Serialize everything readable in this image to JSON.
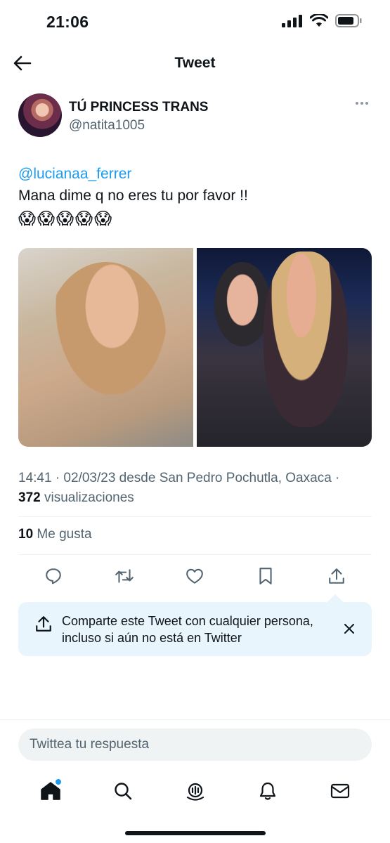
{
  "status_bar": {
    "time": "21:06"
  },
  "nav": {
    "title": "Tweet"
  },
  "tweet": {
    "author": {
      "display_name": "TÚ PRINCESS TRANS",
      "handle": "@natita1005"
    },
    "mention": "@lucianaa_ferrer",
    "text": "Mana dime q no eres tu por favor !!",
    "emojis": "😱😱😱😱😱",
    "timestamp_line": "14:41 · 02/03/23 desde San Pedro Pochutla, Oaxaca ·",
    "views_count": "372",
    "views_label": "visualizaciones",
    "likes_count": "10",
    "likes_label": "Me gusta"
  },
  "share_card": {
    "text": "Comparte este Tweet con cualquier persona, incluso si aún no está en Twitter"
  },
  "reply": {
    "placeholder": "Twittea tu respuesta"
  },
  "icons": {
    "back": "back-arrow-icon",
    "more": "more-dots-icon",
    "actions": [
      "reply-icon",
      "retweet-icon",
      "like-icon",
      "bookmark-icon",
      "share-icon"
    ],
    "tabs": [
      "home-icon",
      "search-icon",
      "spaces-icon",
      "notifications-icon",
      "messages-icon"
    ]
  },
  "colors": {
    "accent": "#1d9bf0",
    "text": "#0f1419",
    "secondary": "#536471",
    "share_card_bg": "#e8f5fd"
  }
}
